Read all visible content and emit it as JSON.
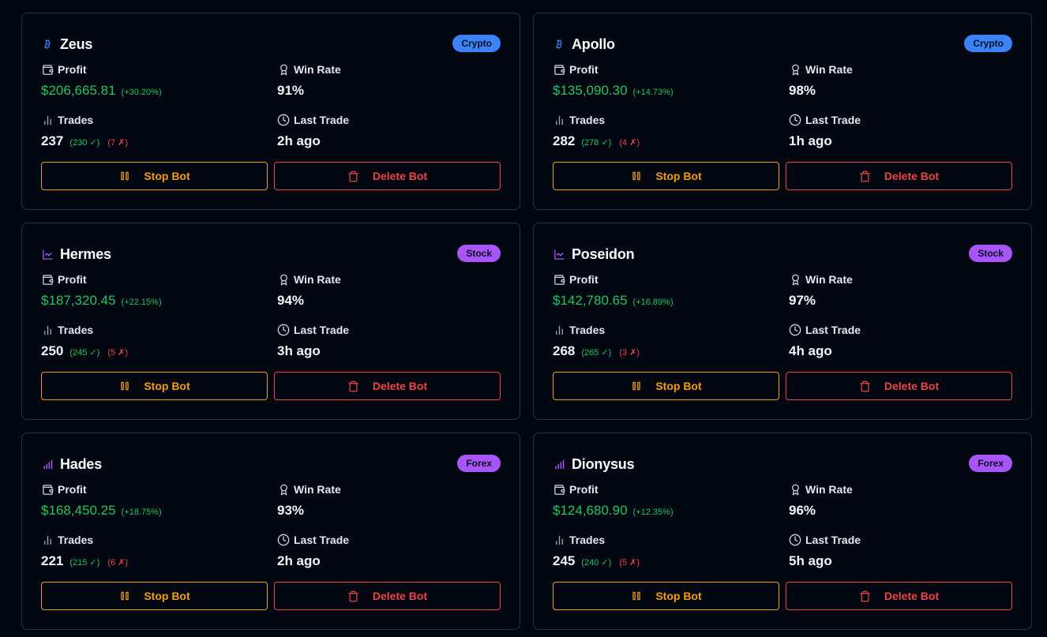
{
  "labels": {
    "profit": "Profit",
    "win_rate": "Win Rate",
    "trades": "Trades",
    "last_trade": "Last Trade",
    "stop_bot": "Stop Bot",
    "delete_bot": "Delete Bot"
  },
  "colors": {
    "background": "#030712",
    "card_border": "#2b3240",
    "profit_green": "#22c55e",
    "loss_red": "#ef4444",
    "stop_amber": "#f59e0b",
    "crypto_blue": "#3b82f6",
    "stock_purple": "#a855f7"
  },
  "bots": [
    {
      "name": "Zeus",
      "category": "Crypto",
      "icon": "bitcoin-icon",
      "profit": "$206,665.81",
      "profit_pct": "(+30.20%)",
      "win_rate": "91%",
      "trades": "237",
      "wins": "(230 ✓)",
      "losses": "(7 ✗)",
      "last_trade": "2h ago"
    },
    {
      "name": "Apollo",
      "category": "Crypto",
      "icon": "bitcoin-icon",
      "profit": "$135,090.30",
      "profit_pct": "(+14.73%)",
      "win_rate": "98%",
      "trades": "282",
      "wins": "(278 ✓)",
      "losses": "(4 ✗)",
      "last_trade": "1h ago"
    },
    {
      "name": "Hermes",
      "category": "Stock",
      "icon": "line-chart-icon",
      "profit": "$187,320.45",
      "profit_pct": "(+22.15%)",
      "win_rate": "94%",
      "trades": "250",
      "wins": "(245 ✓)",
      "losses": "(5 ✗)",
      "last_trade": "3h ago"
    },
    {
      "name": "Poseidon",
      "category": "Stock",
      "icon": "line-chart-icon",
      "profit": "$142,780.65",
      "profit_pct": "(+16.89%)",
      "win_rate": "97%",
      "trades": "268",
      "wins": "(265 ✓)",
      "losses": "(3 ✗)",
      "last_trade": "4h ago"
    },
    {
      "name": "Hades",
      "category": "Forex",
      "icon": "signal-bars-icon",
      "profit": "$168,450.25",
      "profit_pct": "(+18.75%)",
      "win_rate": "93%",
      "trades": "221",
      "wins": "(215 ✓)",
      "losses": "(6 ✗)",
      "last_trade": "2h ago"
    },
    {
      "name": "Dionysus",
      "category": "Forex",
      "icon": "signal-bars-icon",
      "profit": "$124,680.90",
      "profit_pct": "(+12.35%)",
      "win_rate": "96%",
      "trades": "245",
      "wins": "(240 ✓)",
      "losses": "(5 ✗)",
      "last_trade": "5h ago"
    }
  ]
}
